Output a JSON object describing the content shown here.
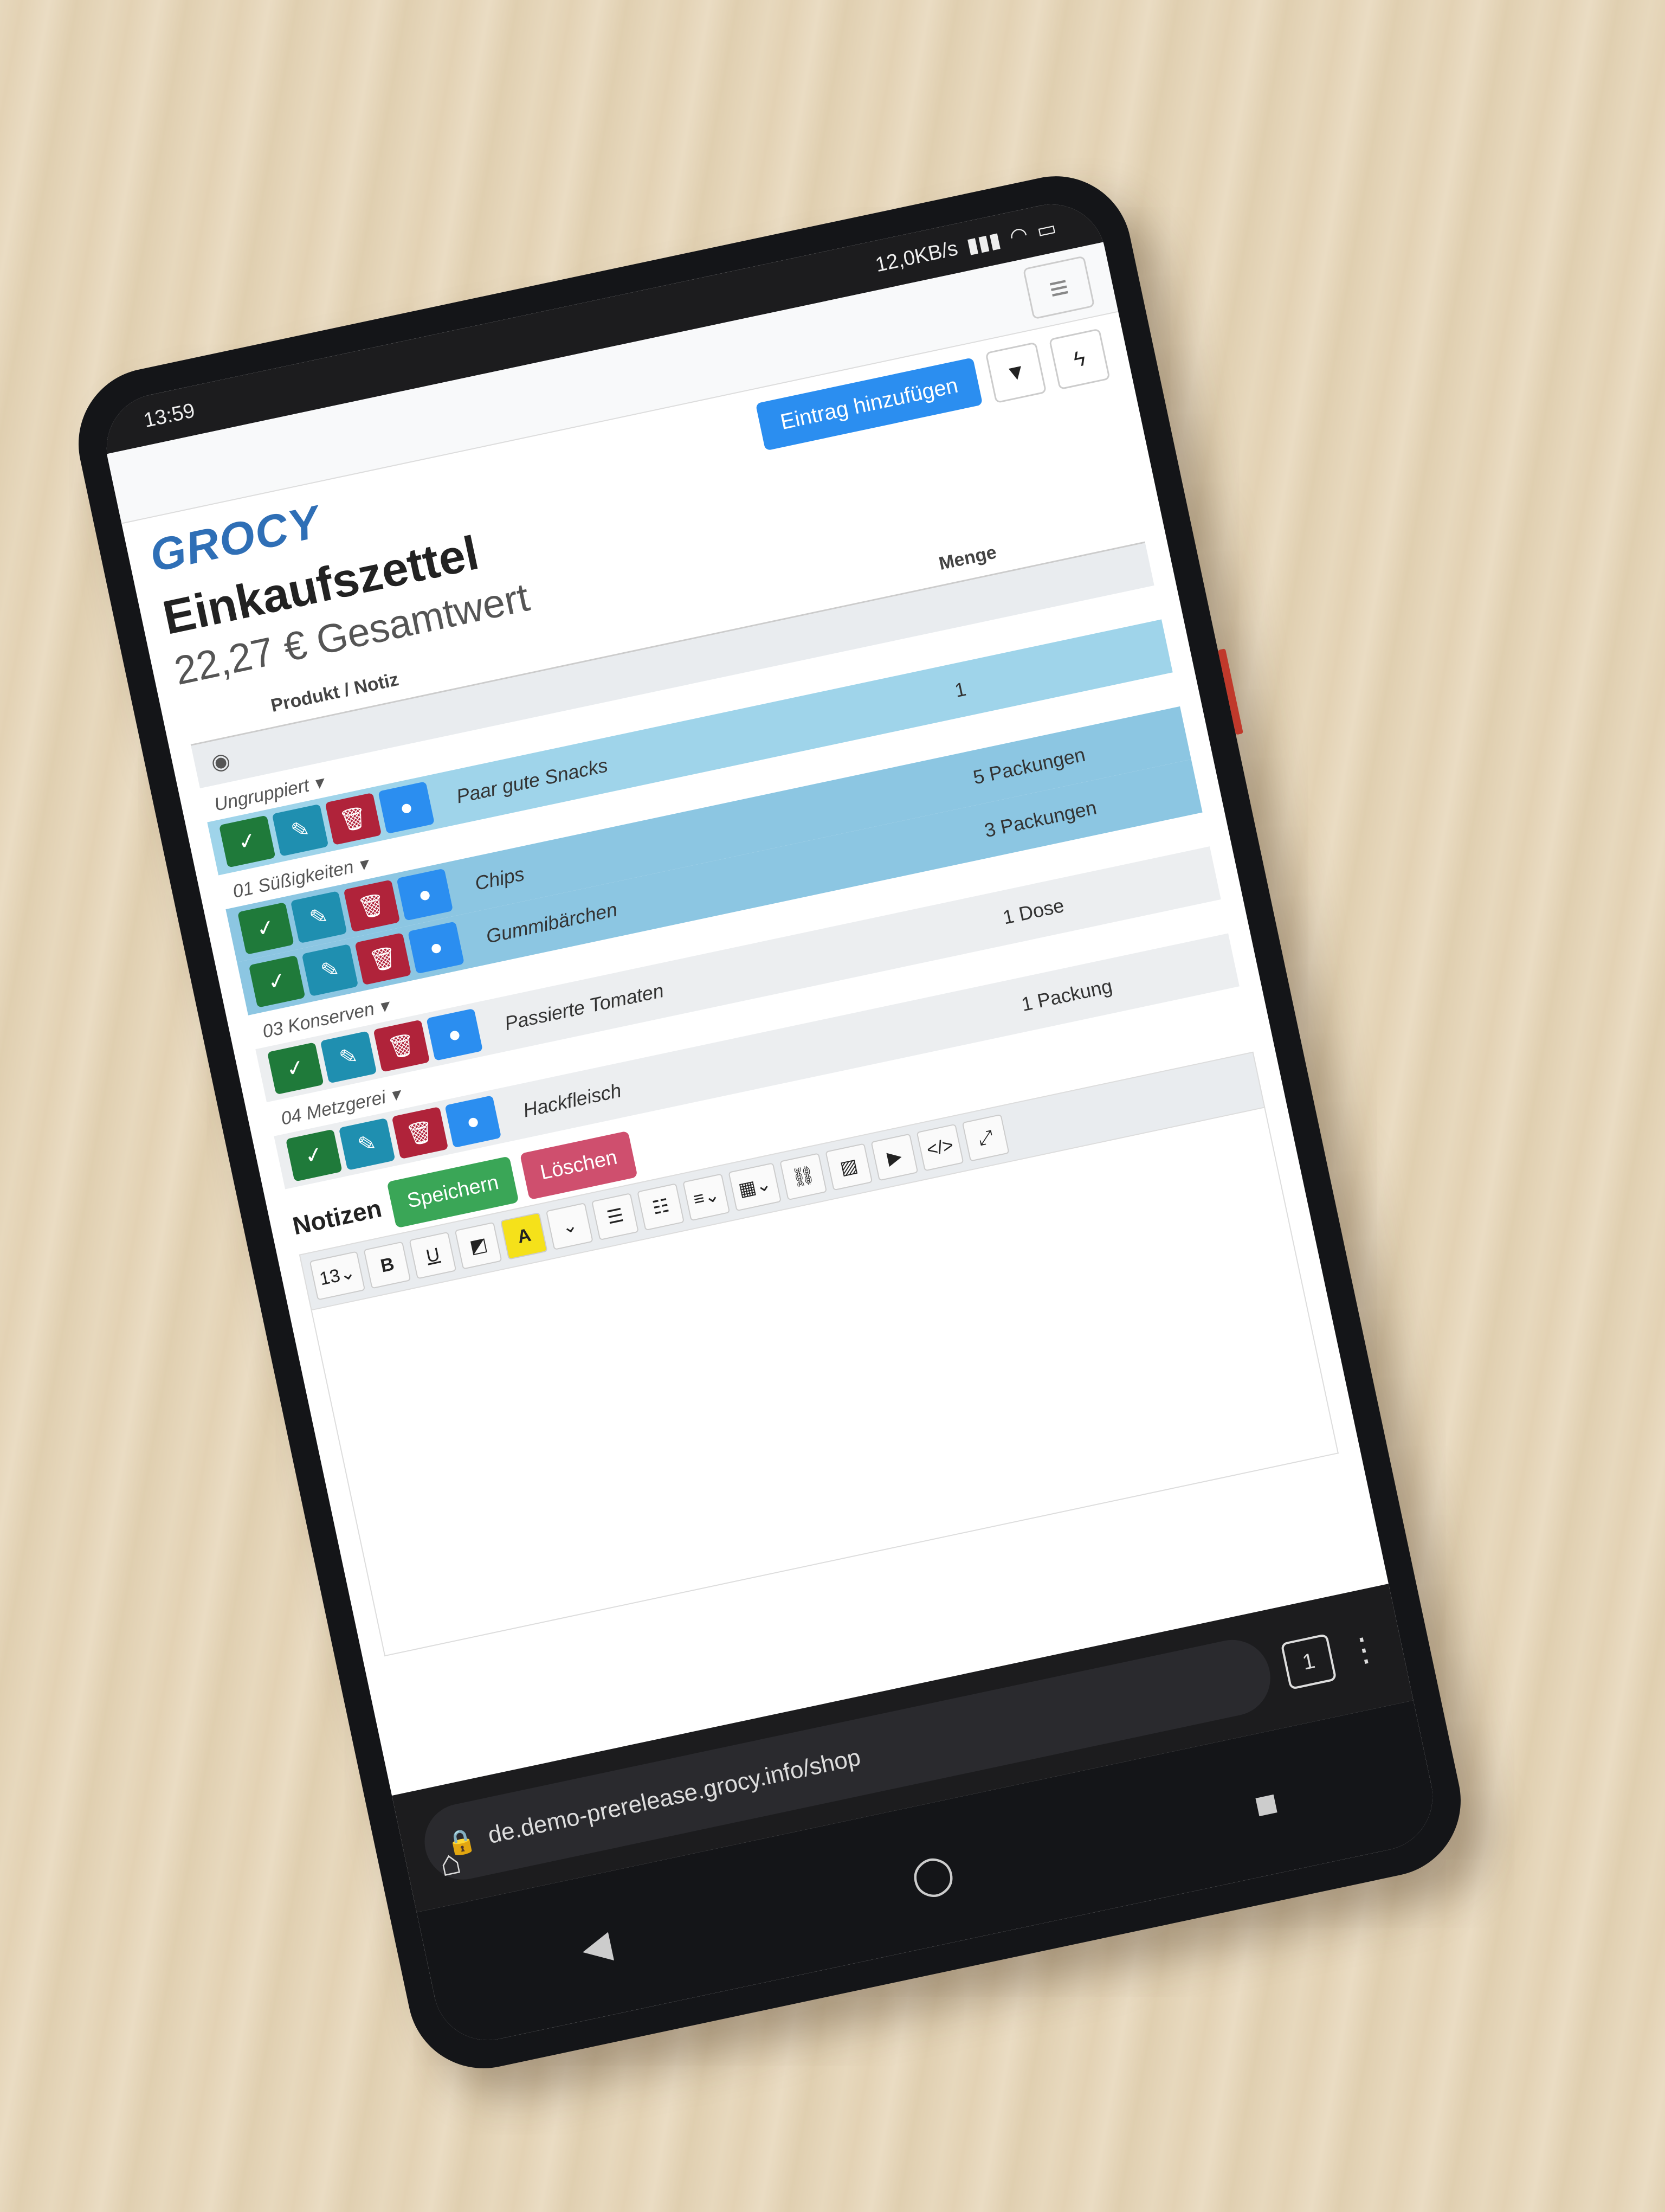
{
  "status": {
    "time": "13:59",
    "net": "12,0KB/s"
  },
  "header": {
    "logo": "GROCY",
    "add_label": "Eintrag hinzufügen"
  },
  "page": {
    "title": "Einkaufszettel",
    "total": "22,27 € Gesamtwert",
    "col_product": "Produkt / Notiz",
    "col_amount": "Menge"
  },
  "groups": [
    {
      "name": "Ungruppiert",
      "items": [
        {
          "name": "Paar gute Snacks",
          "qty": "1"
        }
      ]
    },
    {
      "name": "01 Süßigkeiten",
      "items": [
        {
          "name": "Chips",
          "qty": "5 Packungen"
        },
        {
          "name": "Gummibärchen",
          "qty": "3 Packungen"
        }
      ]
    },
    {
      "name": "03 Konserven",
      "items": [
        {
          "name": "Passierte Tomaten",
          "qty": "1 Dose"
        }
      ]
    },
    {
      "name": "04 Metzgerei",
      "items": [
        {
          "name": "Hackfleisch",
          "qty": "1 Packung"
        }
      ]
    }
  ],
  "notes": {
    "label": "Notizen",
    "save": "Speichern",
    "delete": "Löschen",
    "font_size": "13"
  },
  "browser": {
    "url": "de.demo-prerelease.grocy.info/shop",
    "tabs": "1"
  }
}
